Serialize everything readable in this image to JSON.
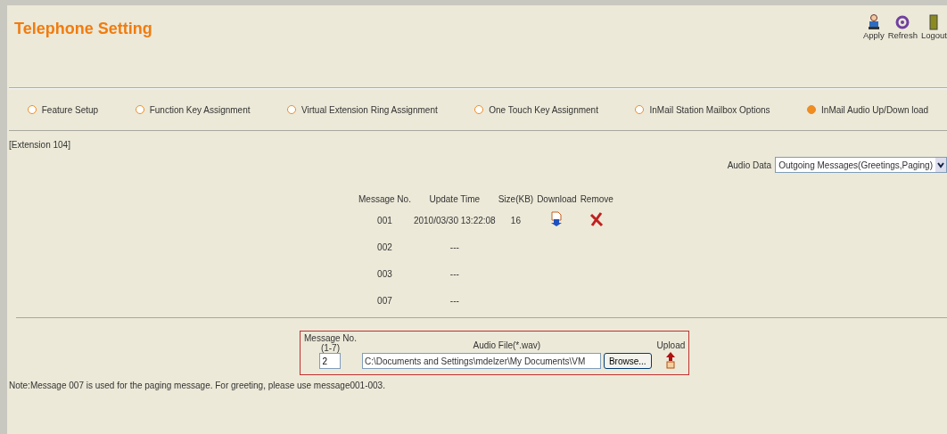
{
  "header": {
    "title": "Telephone Setting",
    "actions": [
      {
        "kind": "apply",
        "label": "Apply"
      },
      {
        "kind": "refresh",
        "label": "Refresh"
      },
      {
        "kind": "logout",
        "label": "Logout"
      }
    ]
  },
  "tabs": [
    {
      "label": "Feature Setup",
      "selected": false
    },
    {
      "label": "Function Key Assignment",
      "selected": false
    },
    {
      "label": "Virtual Extension Ring Assignment",
      "selected": false
    },
    {
      "label": "One Touch Key Assignment",
      "selected": false
    },
    {
      "label": "InMail Station Mailbox Options",
      "selected": false
    },
    {
      "label": "InMail Audio Up/Down load",
      "selected": true
    }
  ],
  "extension": "[Extension 104]",
  "audio_data": {
    "label": "Audio Data",
    "value": "Outgoing Messages(Greetings,Paging)"
  },
  "table": {
    "columns": [
      "Message No.",
      "Update Time",
      "Size(KB)",
      "Download",
      "Remove"
    ],
    "rows": [
      {
        "no": "001",
        "time": "2010/03/30 13:22:08",
        "size": "16",
        "has_file": true
      },
      {
        "no": "002",
        "time": "---",
        "has_file": false
      },
      {
        "no": "003",
        "time": "---",
        "has_file": false
      },
      {
        "no": "007",
        "time": "---",
        "has_file": false
      }
    ]
  },
  "upload": {
    "message_label": "Message No.\n(1-7)",
    "file_label": "Audio File(*.wav)",
    "upload_label": "Upload",
    "message_value": "2",
    "file_value": "C:\\Documents and Settings\\mdelzer\\My Documents\\VM",
    "browse": "Browse..."
  },
  "note": "Note:Message 007 is used for the paging message. For greeting, please use message001-003."
}
